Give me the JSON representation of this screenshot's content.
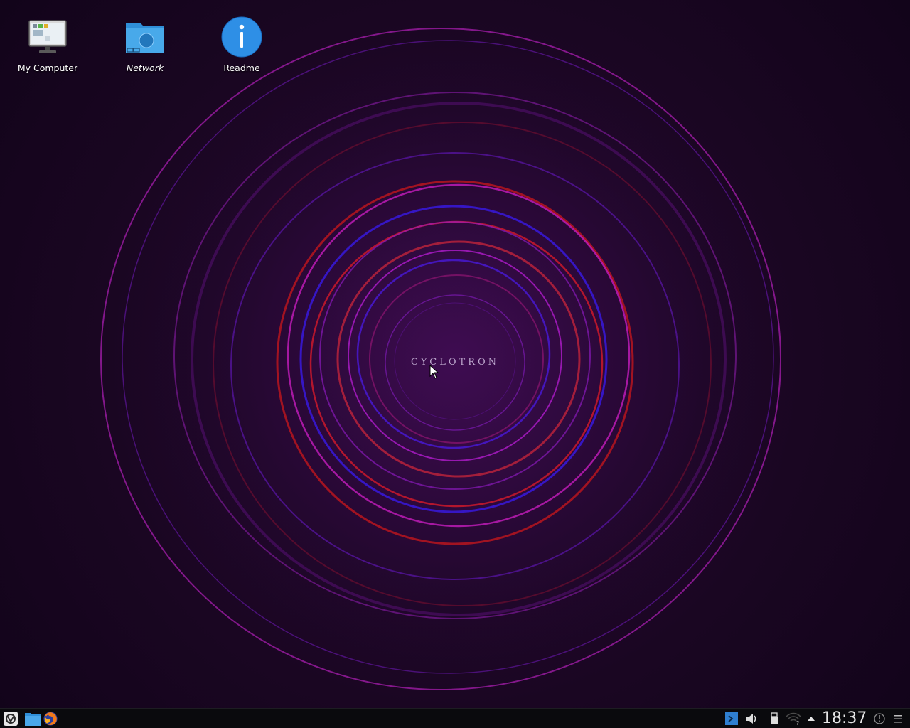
{
  "desktop": {
    "wallpaper_text": "CYCLOTRON",
    "icons": [
      {
        "label": "My Computer",
        "icon": "computer-monitor-icon"
      },
      {
        "label": "Network",
        "icon": "network-folder-icon"
      },
      {
        "label": "Readme",
        "icon": "info-icon"
      }
    ]
  },
  "taskbar": {
    "launchers": [
      {
        "icon": "application-menu-icon"
      },
      {
        "icon": "file-manager-icon"
      },
      {
        "icon": "firefox-icon"
      }
    ],
    "tray": [
      {
        "icon": "konsole-terminal-icon"
      },
      {
        "icon": "volume-icon"
      },
      {
        "icon": "usb-device-icon"
      },
      {
        "icon": "network-wifi-icon"
      },
      {
        "icon": "show-hidden-icons-arrow"
      },
      {
        "icon": "notifications-icon"
      },
      {
        "icon": "panel-menu-icon"
      }
    ],
    "clock": "18:37"
  },
  "colors": {
    "background": "#1a0622",
    "ring_magenta": "#c026d3",
    "ring_red": "#e11d2a",
    "ring_blue": "#3b1cff",
    "ring_purple": "#7a22c8",
    "taskbar": "#0a0a0d",
    "tray_accent": "#2f7fd1"
  }
}
